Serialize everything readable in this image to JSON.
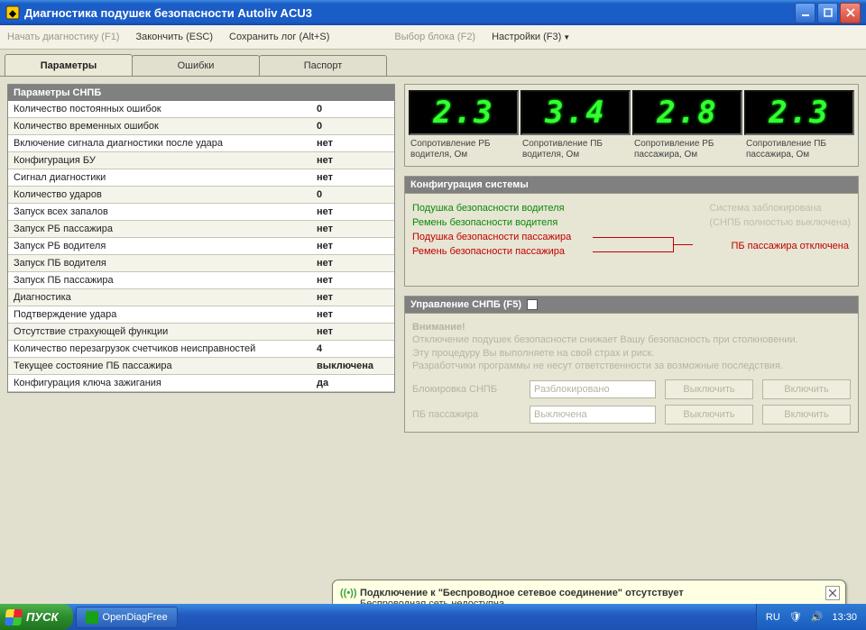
{
  "window": {
    "title": "Диагностика подушек безопасности Autoliv ACU3"
  },
  "menu": {
    "start_diag": "Начать диагностику (F1)",
    "finish": "Закончить (ESC)",
    "save_log": "Сохранить лог (Alt+S)",
    "select_block": "Выбор блока (F2)",
    "settings": "Настройки (F3)"
  },
  "tabs": {
    "params": "Параметры",
    "errors": "Ошибки",
    "passport": "Паспорт"
  },
  "param_header": "Параметры СНПБ",
  "params": [
    {
      "n": "Количество постоянных ошибок",
      "v": "0"
    },
    {
      "n": "Количество временных ошибок",
      "v": "0"
    },
    {
      "n": "Включение сигнала диагностики после удара",
      "v": "нет"
    },
    {
      "n": "Конфигурация БУ",
      "v": "нет"
    },
    {
      "n": "Сигнал диагностики",
      "v": "нет"
    },
    {
      "n": "Количество ударов",
      "v": "0"
    },
    {
      "n": "Запуск всех запалов",
      "v": "нет"
    },
    {
      "n": "Запуск РБ пассажира",
      "v": "нет"
    },
    {
      "n": "Запуск РБ водителя",
      "v": "нет"
    },
    {
      "n": "Запуск ПБ водителя",
      "v": "нет"
    },
    {
      "n": "Запуск ПБ пассажира",
      "v": "нет"
    },
    {
      "n": "Диагностика",
      "v": "нет"
    },
    {
      "n": "Подтверждение удара",
      "v": "нет"
    },
    {
      "n": "Отсутствие страхующей функции",
      "v": "нет"
    },
    {
      "n": "Количество перезагрузок счетчиков неисправностей",
      "v": "4"
    },
    {
      "n": "Текущее состояние ПБ пассажира",
      "v": "выключена"
    },
    {
      "n": "Конфигурация ключа зажигания",
      "v": "да"
    }
  ],
  "gauges": [
    {
      "v": "2.3",
      "l1": "Сопротивление РБ",
      "l2": "водителя, Ом"
    },
    {
      "v": "3.4",
      "l1": "Сопротивление ПБ",
      "l2": "водителя, Ом"
    },
    {
      "v": "2.8",
      "l1": "Сопротивление РБ",
      "l2": "пассажира, Ом"
    },
    {
      "v": "2.3",
      "l1": "Сопротивление ПБ",
      "l2": "пассажира, Ом"
    }
  ],
  "cfg": {
    "title": "Конфигурация системы",
    "driver_pb": "Подушка безопасности водителя",
    "driver_rb": "Ремень безопасности водителя",
    "pass_pb": "Подушка безопасности пассажира",
    "pass_rb": "Ремень безопасности пассажира",
    "sys_locked": "Система заблокирована",
    "sys_off": "(СНПБ полностью выключена)",
    "pb_pass_off": "ПБ пассажира отключена"
  },
  "ctrl": {
    "title": "Управление СНПБ (F5)",
    "warn_h": "Внимание!",
    "warn_1": "Отключение подушек безопасности снижает Вашу безопасность при столкновении.",
    "warn_2": "Эту процедуру Вы выполняете на свой страх и риск.",
    "warn_3": "Разработчики программы не несут ответственности за возможные последствия.",
    "lock_lbl": "Блокировка СНПБ",
    "lock_val": "Разблокировано",
    "pb_lbl": "ПБ пассажира",
    "pb_val": "Выключена",
    "btn_off": "Выключить",
    "btn_on": "Включить"
  },
  "balloon": {
    "title": "Подключение  к  \"Беспроводное сетевое соединение\" отсутствует",
    "body": "Беспроводная сеть недоступна"
  },
  "taskbar": {
    "start": "ПУСК",
    "task1": "OpenDiagFree",
    "lang": "RU",
    "clock": "13:30"
  }
}
